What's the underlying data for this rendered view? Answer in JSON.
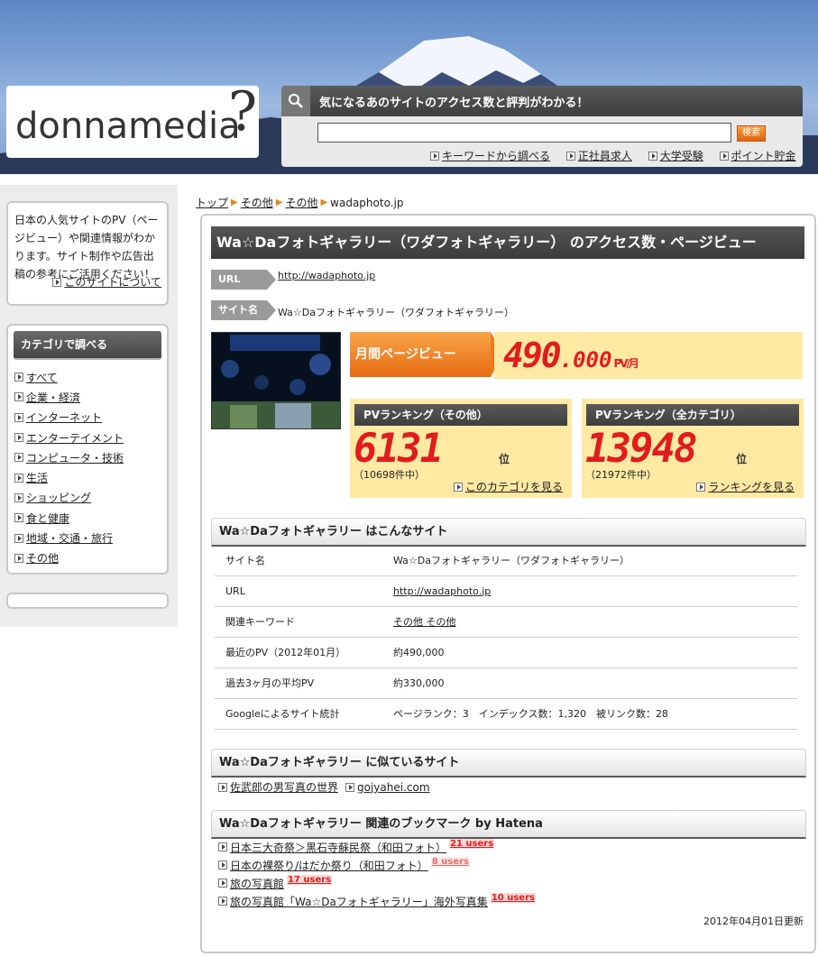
{
  "header": {
    "logo_text": "donnamedia",
    "logo_mark": "?",
    "search_title": "気になるあのサイトのアクセス数と評判がわかる！",
    "search_button": "検索",
    "search_value": "",
    "links": [
      "キーワードから調べる",
      "正社員求人",
      "大学受験",
      "ポイント貯金"
    ]
  },
  "sidebar": {
    "intro_text": "日本の人気サイトのPV（ページビュー）や関連情報がわかります。サイト制作や広告出稿の参考にご活用ください！",
    "intro_link": "このサイトについて",
    "category_header": "カテゴリで調べる",
    "categories": [
      "すべて",
      "企業・経済",
      "インターネット",
      "エンターテイメント",
      "コンピュータ・技術",
      "生活",
      "ショッピング",
      "食と健康",
      "地域・交通・旅行",
      "その他"
    ]
  },
  "breadcrumb": [
    "トップ",
    "その他",
    "その他",
    "wadaphoto.jp"
  ],
  "main": {
    "title": "Wa☆Daフォトギャラリー（ワダフォトギャラリー） のアクセス数・ページビュー",
    "url_label": "URL",
    "url_value": "http://wadaphoto.jp",
    "name_label": "サイト名",
    "name_value": "Wa☆Daフォトギャラリー（ワダフォトギャラリー）",
    "monthly_label": "月間ページビュー",
    "monthly_pv_big": "490",
    "monthly_pv_small": ".000",
    "monthly_pv_unit": "PV/月",
    "rank_category": {
      "header": "PVランキング（その他）",
      "rank": "6131",
      "unit": "位",
      "count": "（10698件中）",
      "link": "このカテゴリを見る"
    },
    "rank_all": {
      "header": "PVランキング（全カテゴリ）",
      "rank": "13948",
      "unit": "位",
      "count": "（21972件中）",
      "link": "ランキングを見る"
    }
  },
  "about": {
    "heading": "Wa☆Daフォトギャラリー はこんなサイト",
    "rows": [
      {
        "key": "サイト名",
        "value": "Wa☆Daフォトギャラリー（ワダフォトギャラリー）"
      },
      {
        "key": "URL",
        "value": "http://wadaphoto.jp"
      },
      {
        "key": "関連キーワード",
        "value": "その他 その他"
      },
      {
        "key": "最近のPV（2012年01月）",
        "value": "約490,000"
      },
      {
        "key": "過去3ヶ月の平均PV",
        "value": "約330,000"
      },
      {
        "key": "Googleによるサイト統計",
        "value": "ページランク：3　インデックス数：1,320　被リンク数：28"
      }
    ]
  },
  "similar": {
    "heading": "Wa☆Daフォトギャラリー に似ているサイト",
    "items": [
      "佐武郎の男写真の世界",
      "gojyahei.com"
    ]
  },
  "bookmarks": {
    "heading": "Wa☆Daフォトギャラリー 関連のブックマーク by Hatena",
    "items": [
      {
        "title": "日本三大奇祭＞黒石寺蘇民祭（和田フォト）",
        "users": "21 users"
      },
      {
        "title": "日本の裸祭り/はだか祭り（和田フォト）",
        "users": "8 users"
      },
      {
        "title": "旅の写真館",
        "users": "17 users"
      },
      {
        "title": "旅の写真館「Wa☆Daフォトギャラリー」海外写真集",
        "users": "10 users"
      }
    ]
  },
  "updated": "2012年04月01日更新"
}
